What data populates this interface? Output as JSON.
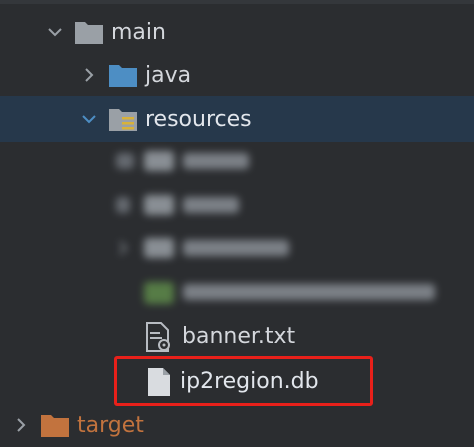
{
  "project_tree": {
    "items": [
      {
        "label": "main",
        "expanded": true
      },
      {
        "label": "java",
        "expanded": false
      },
      {
        "label": "resources",
        "expanded": true,
        "selected": true
      },
      {
        "label": "banner.txt"
      },
      {
        "label": "ip2region.db",
        "highlighted": true
      },
      {
        "label": "target",
        "expanded": false,
        "excluded": true
      }
    ]
  },
  "colors": {
    "background": "#2b2d30",
    "selection": "#26384b",
    "folder": "#9aa0a6",
    "source_folder": "#4d8ec4",
    "excluded_folder": "#c2733e",
    "highlight_box": "#e8201a"
  }
}
